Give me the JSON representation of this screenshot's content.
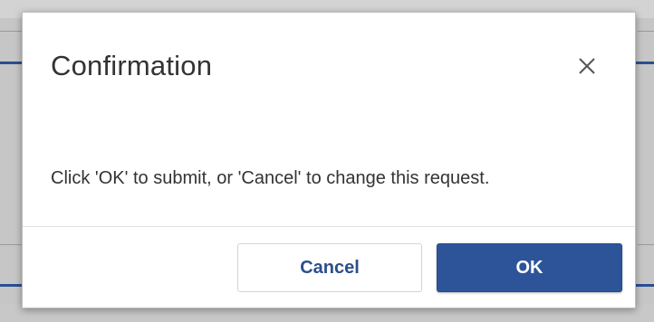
{
  "dialog": {
    "title": "Confirmation",
    "close_icon": "close-icon",
    "message": "Click 'OK' to submit, or 'Cancel' to change this request.",
    "buttons": {
      "cancel_label": "Cancel",
      "ok_label": "OK"
    }
  },
  "colors": {
    "primary": "#2d5499",
    "cancel_text": "#2c4e8c",
    "backdrop": "#c6c6c6",
    "text": "#333333"
  }
}
